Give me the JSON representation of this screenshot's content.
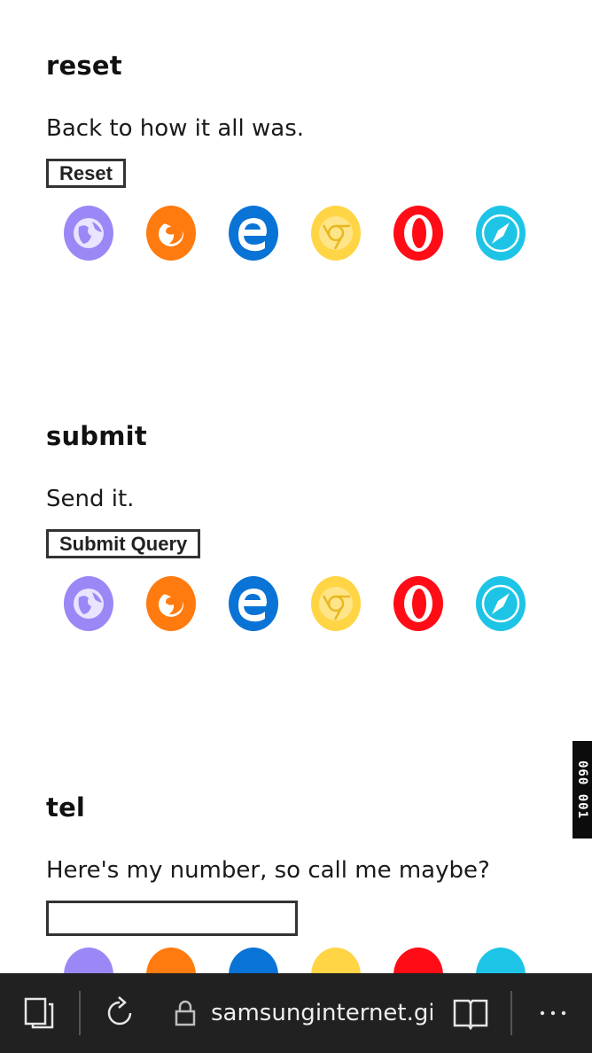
{
  "sections": [
    {
      "title": "reset",
      "description": "Back to how it all was.",
      "control_type": "button",
      "button_label": "Reset",
      "browsers": [
        "samsung-internet",
        "firefox",
        "edge",
        "chrome",
        "opera",
        "safari"
      ]
    },
    {
      "title": "submit",
      "description": "Send it.",
      "control_type": "button",
      "button_label": "Submit Query",
      "browsers": [
        "samsung-internet",
        "firefox",
        "edge",
        "chrome",
        "opera",
        "safari"
      ]
    },
    {
      "title": "tel",
      "description": "Here's my number, so call me maybe?",
      "control_type": "input",
      "input_value": "",
      "browsers": [
        "samsung-internet",
        "firefox",
        "edge",
        "chrome",
        "opera",
        "safari"
      ]
    }
  ],
  "side_tag": "060 001",
  "bottom_bar": {
    "url": "samsunginternet.gitl",
    "icons": [
      "tabs-icon",
      "reload-icon",
      "lock-icon",
      "reader-icon",
      "more-icon"
    ]
  },
  "colors": {
    "samsung": "#9b87f5",
    "firefox": "#ff7b0f",
    "edge": "#0a73d6",
    "chrome": "#ffd545",
    "opera": "#ff0c16",
    "safari": "#1ec4e6",
    "bottom_bar": "#212121"
  }
}
